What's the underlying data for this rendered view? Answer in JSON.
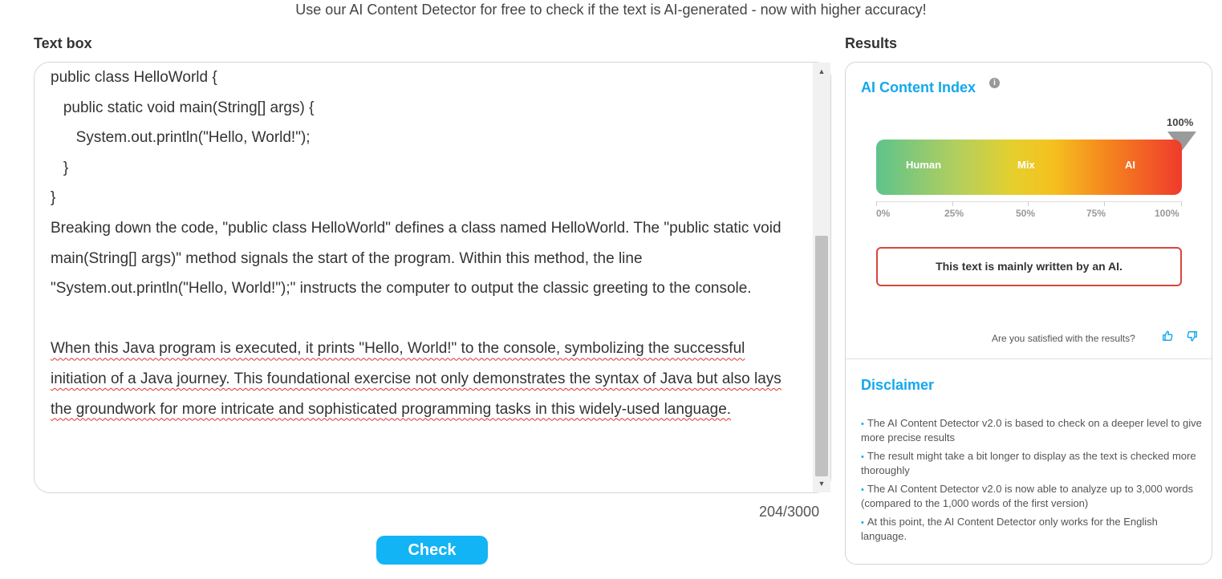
{
  "header": {
    "tagline": "Use our AI Content Detector for free to check if the text is AI-generated - now with higher accuracy!"
  },
  "textbox": {
    "label": "Text box",
    "code_lines": [
      "public class HelloWorld {",
      "   public static void main(String[] args) {",
      "      System.out.println(\"Hello, World!\");",
      "   }",
      "}"
    ],
    "paragraph1": "Breaking down the code, \"public class HelloWorld\" defines a class named HelloWorld. The \"public static void main(String[] args)\" method signals the start of the program. Within this method, the line \"System.out.println(\"Hello, World!\");\" instructs the computer to output the classic greeting to the console.",
    "paragraph2": "When this Java program is executed, it prints \"Hello, World!\" to the console, symbolizing the successful initiation of a Java journey. This foundational exercise not only demonstrates the syntax of Java but also lays the groundwork for more intricate and sophisticated programming tasks in this widely-used language.",
    "counter": "204/3000"
  },
  "actions": {
    "check_label": "Check"
  },
  "results": {
    "label": "Results",
    "ai_index_title": "AI Content Index",
    "info_icon_glyph": "i",
    "score_label": "100%",
    "score_value": 100,
    "gauge_labels": {
      "human": "Human",
      "mix": "Mix",
      "ai": "AI"
    },
    "axis_ticks": [
      "0%",
      "25%",
      "50%",
      "75%",
      "100%"
    ],
    "verdict": "This text is mainly written by an AI.",
    "satisfied_prompt": "Are you satisfied with the results?",
    "thumb_up_icon": "thumbs-up-icon",
    "thumb_down_icon": "thumbs-down-icon",
    "verdict_border_color": "#d9453c",
    "accent_color": "#13a8ee"
  },
  "disclaimer": {
    "title": "Disclaimer",
    "items": [
      "The AI Content Detector v2.0 is based to check on a deeper level to give more precise results",
      "The result might take a bit longer to display as the text is checked more thoroughly",
      "The AI Content Detector v2.0 is now able to analyze up to 3,000 words (compared to the 1,000 words of the first version)",
      "At this point, the AI Content Detector only works for the English language."
    ]
  }
}
